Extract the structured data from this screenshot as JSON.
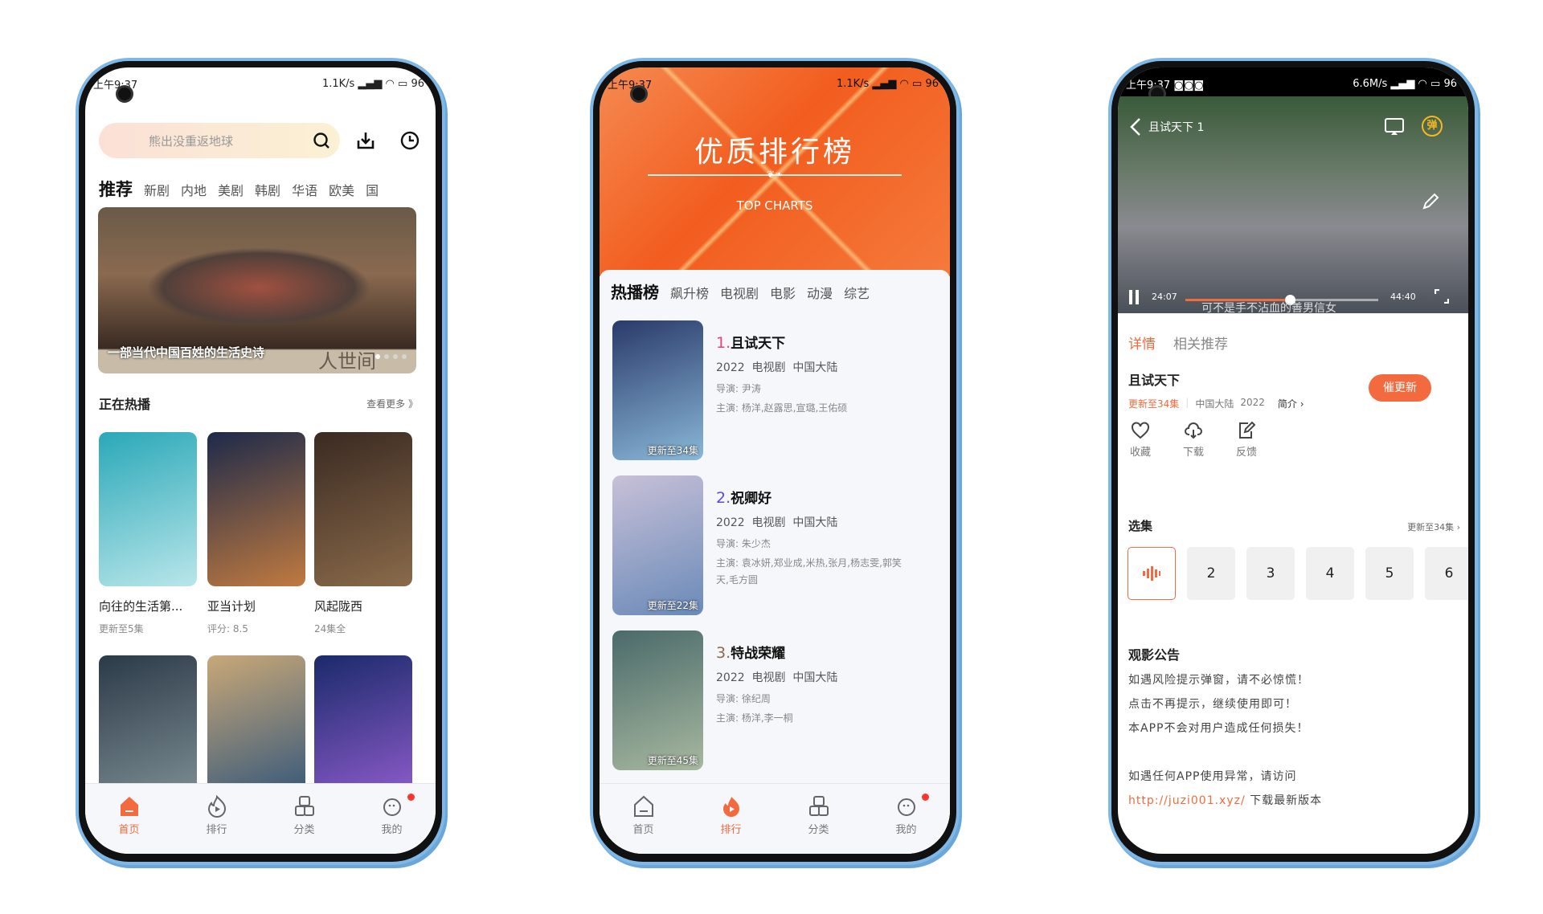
{
  "status": {
    "time": "上午9:37",
    "speed1": "1.1K/s",
    "speed3": "6.6M/s",
    "battery": "96"
  },
  "home": {
    "search_placeholder": "熊出没重返地球",
    "tabs": [
      "推荐",
      "新剧",
      "内地",
      "美剧",
      "韩剧",
      "华语",
      "欧美",
      "国"
    ],
    "banner_caption": "一部当代中国百姓的生活史诗",
    "banner_logo": "人世间",
    "section_title": "正在热播",
    "more": "查看更多 》",
    "cards": [
      {
        "title": "向往的生活第...",
        "sub": "更新至5集",
        "colors": [
          "#2aa8b8",
          "#b9e6ea"
        ]
      },
      {
        "title": "亚当计划",
        "sub": "评分: 8.5",
        "colors": [
          "#1d2a4a",
          "#c07a40"
        ]
      },
      {
        "title": "风起陇西",
        "sub": "24集全",
        "colors": [
          "#3a2a22",
          "#8a6a4a"
        ]
      }
    ],
    "row2_colors": [
      [
        "#2b3a48",
        "#7a8a90"
      ],
      [
        "#c9a878",
        "#3a5a7a"
      ],
      [
        "#1a2a6a",
        "#8a5ac8"
      ]
    ]
  },
  "nav": [
    "首页",
    "排行",
    "分类",
    "我的"
  ],
  "charts": {
    "title": "优质排行榜",
    "subtitle": "TOP CHARTS",
    "tabs": [
      "热播榜",
      "飙升榜",
      "电视剧",
      "电影",
      "动漫",
      "综艺"
    ],
    "items": [
      {
        "rank": "1.",
        "rank_color": "#e8407a",
        "title": "且试天下",
        "meta": "2022  电视剧  中国大陆",
        "director": "导演: 尹涛",
        "cast": "主演: 杨洋,赵露思,宣璐,王佑硕",
        "badge": "更新至34集",
        "colors": [
          "#2a3a6a",
          "#8ab8d8"
        ]
      },
      {
        "rank": "2.",
        "rank_color": "#5a4ae0",
        "title": "祝卿好",
        "meta": "2022  电视剧  中国大陆",
        "director": "导演: 朱少杰",
        "cast": "主演: 袁冰妍,郑业成,米热,张月,杨志雯,郭笑天,毛方圆",
        "badge": "更新至22集",
        "colors": [
          "#c8c0d8",
          "#6a8ab8"
        ]
      },
      {
        "rank": "3.",
        "rank_color": "#8a6a4a",
        "title": "特战荣耀",
        "meta": "2022  电视剧  中国大陆",
        "director": "导演: 徐纪周",
        "cast": "主演: 杨洋,李一桐",
        "badge": "更新至45集",
        "colors": [
          "#4a6a6a",
          "#a8b8a0"
        ]
      }
    ]
  },
  "detail": {
    "video_title": "且试天下 1",
    "danmaku": "弹",
    "time_current": "24:07",
    "time_total": "44:40",
    "progress": 0.54,
    "subtitle": "可不是手不沾血的善男信女",
    "tabs": [
      "详情",
      "相关推荐"
    ],
    "title": "且试天下",
    "update": "更新至34集",
    "region": "中国大陆",
    "year": "2022",
    "intro": "简介 ›",
    "urge_button": "催更新",
    "actions": [
      "收藏",
      "下载",
      "反馈"
    ],
    "episodes_title": "选集",
    "episodes_more": "更新至34集 ›",
    "episodes": [
      "2",
      "3",
      "4",
      "5",
      "6"
    ],
    "notice_title": "观影公告",
    "notice": [
      "如遇风险提示弹窗，请不必惊慌！",
      "点击不再提示，继续使用即可！",
      "本APP不会对用户造成任何损失！",
      "",
      "如遇任何APP使用异常，请访问"
    ],
    "link": "http://juzi001.xyz/",
    "link_suffix": " 下载最新版本"
  },
  "colors": {
    "accent": "#f26a3d",
    "orange_header": "#f36a2c"
  }
}
